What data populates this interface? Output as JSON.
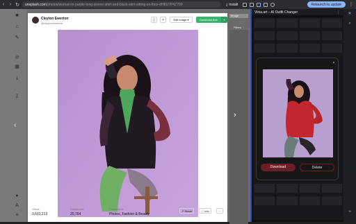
{
  "browser": {
    "url_host": "unsplash.com",
    "url_path": "/photos/woman-in-purple-long-sleeve-shirt-and-black-skirt-sitting-on-floor-dH8U7P4Z700",
    "install_label": "Install",
    "relaunch_label": "Relaunch to update"
  },
  "modal": {
    "username": "Cleyton Ewerton",
    "handle": "@cleytonewerton",
    "edit_label": "Edit image",
    "download_label": "Download free",
    "views_label": "Views",
    "views_value": "3,601,213",
    "downloads_label": "Downloads",
    "downloads_value": "20,764",
    "featured_label": "Featured in",
    "featured_value": "Photos, Fashion & Beauty",
    "share_label": "Share",
    "info_label": "Info",
    "more_label": "···"
  },
  "behind_page": {
    "tag1": "Image",
    "tag2": "Filters"
  },
  "extension": {
    "title": "Vinia.art – AI Outfit Changer",
    "download_label": "Download",
    "delete_label": "Delete"
  },
  "colors": {
    "accent_green": "#3cb46e",
    "panel_border": "#2b50b8",
    "download_red": "#6b1f24"
  }
}
